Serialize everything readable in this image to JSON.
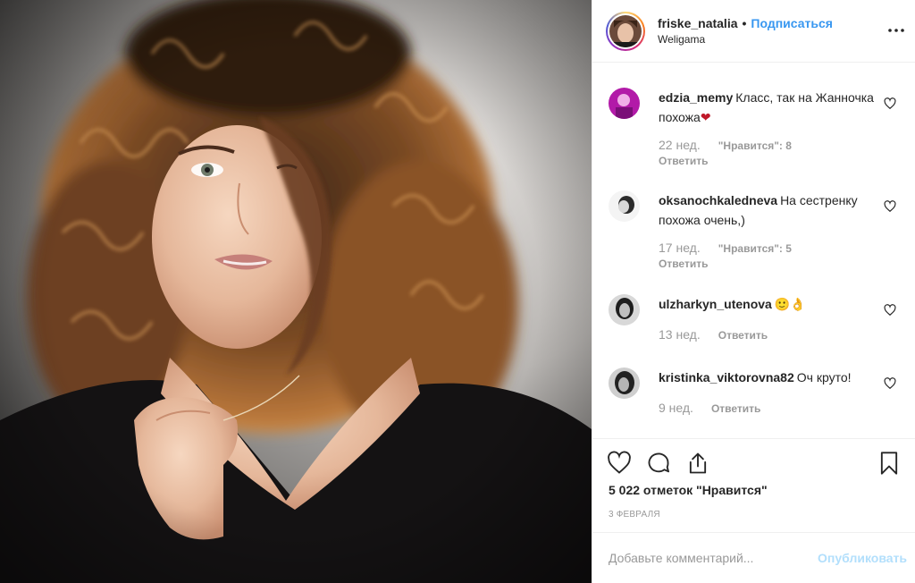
{
  "post": {
    "username": "friske_natalia",
    "separator": "•",
    "follow_label": "Подписаться",
    "location": "Weligama",
    "more_icon": "ellipsis-icon"
  },
  "comments": [
    {
      "username": "edzia_memy",
      "text": "Класс, так на Жанночка похожа",
      "emoji": "❤",
      "time": "22 нед.",
      "likes": "\"Нравится\": 8",
      "reply": "Ответить"
    },
    {
      "username": "oksanochkaledneva",
      "text": "На сестренку похожа очень,)",
      "emoji": "",
      "time": "17 нед.",
      "likes": "\"Нравится\": 5",
      "reply": "Ответить"
    },
    {
      "username": "ulzharkyn_utenova",
      "text": "",
      "emoji": "🙂👌",
      "time": "13 нед.",
      "likes": "",
      "reply": "Ответить"
    },
    {
      "username": "kristinka_viktorovna82",
      "text": "Оч круто!",
      "emoji": "",
      "time": "9 нед.",
      "likes": "",
      "reply": "Ответить"
    }
  ],
  "actions": {
    "like_icon": "heart-icon",
    "comment_icon": "comment-icon",
    "share_icon": "share-icon",
    "save_icon": "bookmark-icon"
  },
  "likes_count": "5 022 отметок \"Нравится\"",
  "date": "3 ФЕВРАЛЯ",
  "add_comment": {
    "placeholder": "Добавьте комментарий...",
    "publish_label": "Опубликовать"
  },
  "colors": {
    "link": "#3897f0",
    "muted": "#999999",
    "publish_disabled": "#b2dffc",
    "heart_red": "#c0192a"
  }
}
